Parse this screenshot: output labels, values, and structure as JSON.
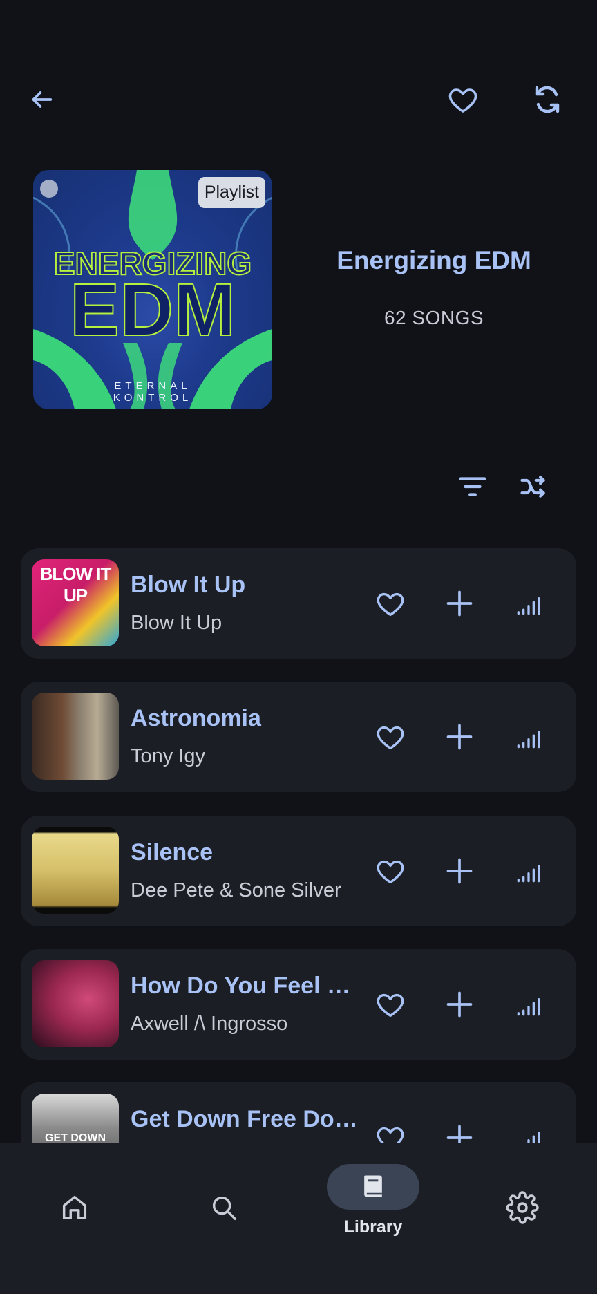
{
  "header": {
    "back_icon": "arrow-left-icon",
    "favorite_icon": "heart-outline-icon",
    "sync_icon": "sync-icon"
  },
  "playlist": {
    "badge": "Playlist",
    "cover_word1": "ENERGIZING",
    "cover_word2": "EDM",
    "cover_brand_line1": "ETERNAL",
    "cover_brand_line2": "KONTROL",
    "title": "Energizing EDM",
    "count": "62 SONGS"
  },
  "actions": {
    "filter_icon": "filter-icon",
    "shuffle_icon": "shuffle-icon"
  },
  "songs": [
    {
      "title": "Blow It Up",
      "artist": "Blow It Up"
    },
    {
      "title": "Astronomia",
      "artist": "Tony Igy"
    },
    {
      "title": "Silence",
      "artist": "Dee Pete & Sone Silver"
    },
    {
      "title": "How Do You Feel R…",
      "artist": "Axwell /\\ Ingrosso"
    },
    {
      "title": "Get Down Free Do…",
      "artist": "",
      "thumb_text": "GET DOWN"
    }
  ],
  "nav": {
    "items": [
      {
        "icon": "home-icon"
      },
      {
        "icon": "search-icon"
      },
      {
        "icon": "library-icon",
        "label": "Library"
      },
      {
        "icon": "settings-icon"
      }
    ],
    "active": "Library"
  },
  "colors": {
    "background": "#101218",
    "card": "#1b1e24",
    "accent": "#a9c2f5",
    "text_secondary": "#c9ccd6"
  }
}
